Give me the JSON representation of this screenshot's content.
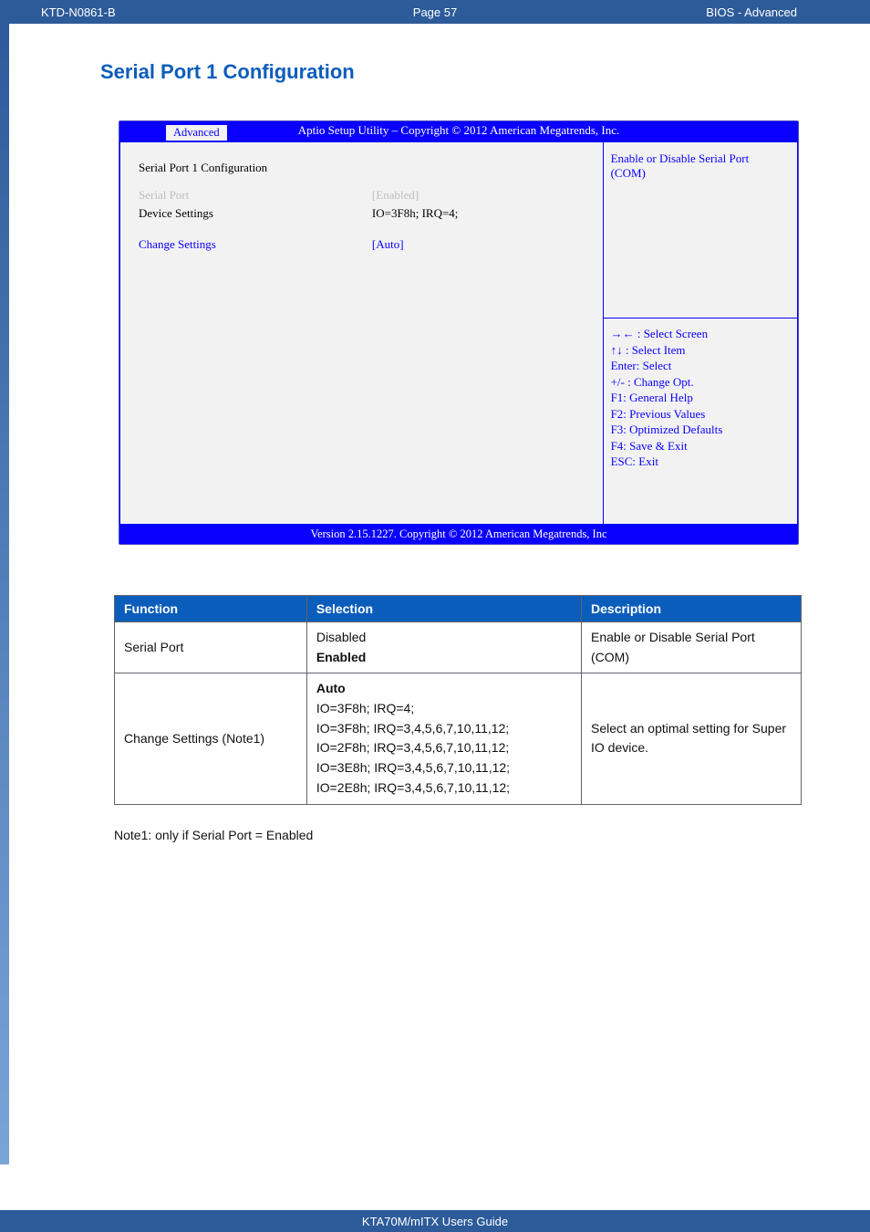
{
  "header": {
    "doc_code": "KTD-N0861-B",
    "page_label": "Page 57",
    "section_label": "BIOS  - Advanced"
  },
  "section_title": "Serial Port 1 Configuration",
  "bios": {
    "top_title": "Aptio Setup Utility  –  Copyright © 2012 American Megatrends, Inc.",
    "active_tab": "Advanced",
    "panel_title": "Serial Port 1 Configuration",
    "rows": {
      "serial_port": {
        "label": "Serial Port",
        "value": "[Enabled]"
      },
      "device": {
        "label": "Device Settings",
        "value": "IO=3F8h; IRQ=4;"
      },
      "change": {
        "label": "Change Settings",
        "value": "[Auto]"
      }
    },
    "help_text_1": "Enable or Disable Serial Port",
    "help_text_2": "(COM)",
    "nav": {
      "l1": "→← : Select Screen",
      "l2": "↑↓ : Select Item",
      "l3": "Enter: Select",
      "l4": "+/- : Change Opt.",
      "l5": "F1: General Help",
      "l6": "F2: Previous Values",
      "l7": "F3: Optimized Defaults",
      "l8": "F4: Save & Exit",
      "l9": "ESC: Exit"
    },
    "footer": "Version 2.15.1227. Copyright © 2012 American Megatrends, Inc"
  },
  "table": {
    "headers": {
      "c1": "Function",
      "c2": "Selection",
      "c3": "Description"
    },
    "rows": [
      {
        "function": "Serial Port",
        "selection": "Disabled\nEnabled",
        "selection_bold_lines": [
          "Enabled"
        ],
        "description": "Enable or Disable Serial Port (COM)"
      },
      {
        "function": "Change Settings     (Note1)",
        "selection": "Auto\nIO=3F8h; IRQ=4;\nIO=3F8h; IRQ=3,4,5,6,7,10,11,12;\nIO=2F8h; IRQ=3,4,5,6,7,10,11,12;\nIO=3E8h; IRQ=3,4,5,6,7,10,11,12;\nIO=2E8h; IRQ=3,4,5,6,7,10,11,12;",
        "selection_bold_lines": [
          "Auto"
        ],
        "description": "Select an optimal setting for Super IO device."
      }
    ]
  },
  "note_text": "Note1: only if Serial Port = Enabled",
  "footer": {
    "guide": "KTA70M/mITX Users Guide"
  }
}
